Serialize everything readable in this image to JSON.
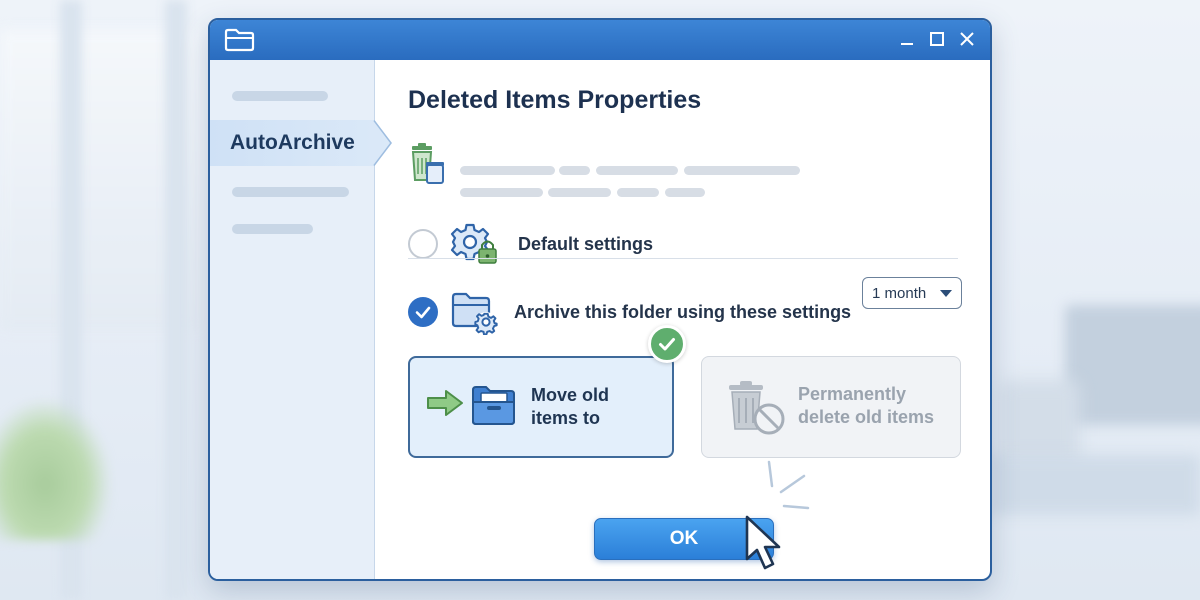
{
  "window": {
    "title_icon": "folder-icon",
    "controls": [
      "minimize-icon",
      "maximize-icon",
      "close-icon"
    ]
  },
  "sidebar": {
    "active_item": "AutoArchive"
  },
  "dialog": {
    "title": "Deleted Items Properties",
    "header_icon": "recycle-bin-icon"
  },
  "options": {
    "default": {
      "label": "Default settings",
      "checked": false,
      "icon": "gear-lock-icon"
    },
    "custom": {
      "label": "Archive this folder using these settings",
      "checked": true,
      "icon": "folder-gear-icon"
    }
  },
  "period_select": {
    "value": "1 month"
  },
  "cards": {
    "move": {
      "label_line1": "Move old",
      "label_line2": "items to",
      "selected": true,
      "icon": "folder-move-icon"
    },
    "delete": {
      "label_line1": "Permanently",
      "label_line2": "delete old items",
      "selected": false,
      "icon": "trash-prohibited-icon"
    }
  },
  "ok_button": {
    "label": "OK"
  },
  "colors": {
    "titlebar": "#2a6cbf",
    "accent": "#2e6ec4",
    "selected_card": "#e3effb",
    "check_green": "#5fae6e"
  }
}
